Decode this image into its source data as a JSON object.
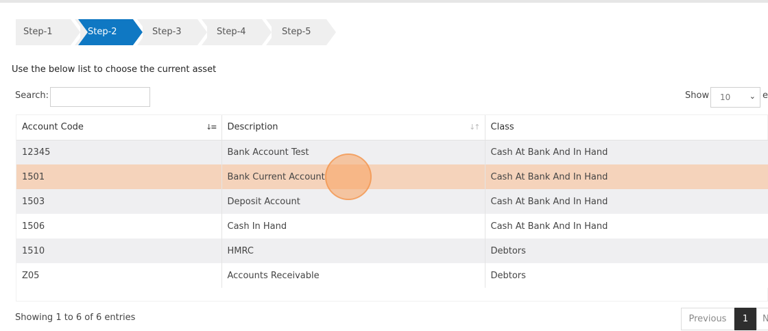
{
  "wizard": {
    "steps": [
      {
        "label": "Step-1",
        "active": false
      },
      {
        "label": "Step-2",
        "active": true
      },
      {
        "label": "Step-3",
        "active": false
      },
      {
        "label": "Step-4",
        "active": false
      },
      {
        "label": "Step-5",
        "active": false
      }
    ]
  },
  "intro": "Use the below list to choose the current asset",
  "search": {
    "label": "Search:",
    "value": ""
  },
  "length": {
    "label": "Show",
    "selected": "10",
    "trailing": "e"
  },
  "table": {
    "columns": [
      "Account Code",
      "Description",
      "Class"
    ],
    "rows": [
      {
        "code": "12345",
        "description": "Bank Account Test",
        "class": "Cash At Bank And In Hand"
      },
      {
        "code": "1501",
        "description": "Bank Current Account",
        "class": "Cash At Bank And In Hand"
      },
      {
        "code": "1503",
        "description": "Deposit Account",
        "class": "Cash At Bank And In Hand"
      },
      {
        "code": "1506",
        "description": "Cash In Hand",
        "class": "Cash At Bank And In Hand"
      },
      {
        "code": "1510",
        "description": "HMRC",
        "class": "Debtors"
      },
      {
        "code": "Z05",
        "description": "Accounts Receivable",
        "class": "Debtors"
      }
    ],
    "selected_row": 1
  },
  "info": "Showing 1 to 6 of 6 entries",
  "pagination": {
    "previous": "Previous",
    "current": "1",
    "next": "Next"
  },
  "colors": {
    "active_step": "#0f78c3",
    "selected_row": "#f5d3bb",
    "click_marker": "#f7a05c"
  }
}
